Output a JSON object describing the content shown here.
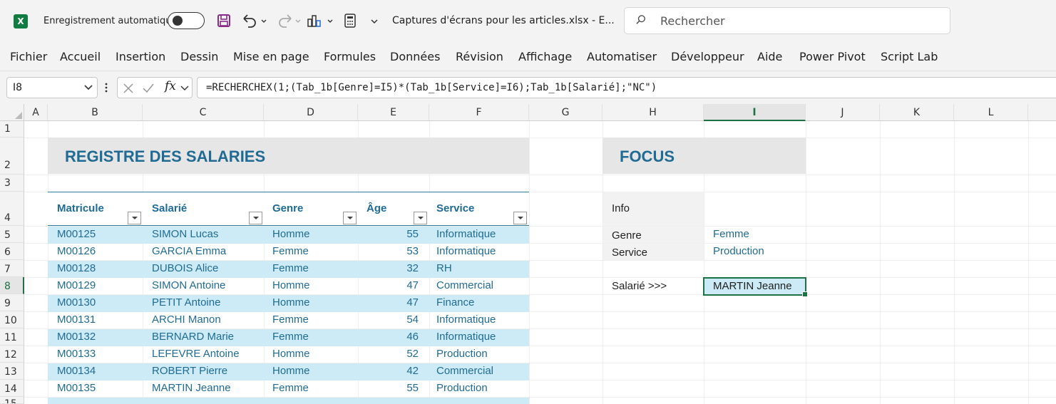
{
  "titlebar": {
    "logo": "X",
    "autosave_label": "Enregistrement automatique",
    "doc_title": "Captures d'écrans pour les articles.xlsx  -  E...",
    "search_placeholder": "Rechercher"
  },
  "ribbon": {
    "tabs": [
      "Fichier",
      "Accueil",
      "Insertion",
      "Dessin",
      "Mise en page",
      "Formules",
      "Données",
      "Révision",
      "Affichage",
      "Automatiser",
      "Développeur",
      "Aide",
      "Power Pivot",
      "Script Lab"
    ]
  },
  "formula_bar": {
    "namebox": "I8",
    "formula": "=RECHERCHEX(1;(Tab_1b[Genre]=I5)*(Tab_1b[Service]=I6);Tab_1b[Salarié];\"NC\")"
  },
  "columns": [
    "A",
    "B",
    "C",
    "D",
    "E",
    "F",
    "G",
    "H",
    "I",
    "J",
    "K",
    "L"
  ],
  "rows": [
    "1",
    "2",
    "3",
    "4",
    "5",
    "6",
    "7",
    "8",
    "9",
    "10",
    "11",
    "12",
    "13",
    "14",
    "15"
  ],
  "register": {
    "title": "REGISTRE DES SALARIES",
    "headers": [
      "Matricule",
      "Salarié",
      "Genre",
      "Âge",
      "Service"
    ],
    "rows": [
      [
        "M00125",
        "SIMON Lucas",
        "Homme",
        "55",
        "Informatique"
      ],
      [
        "M00126",
        "GARCIA Emma",
        "Femme",
        "53",
        "Informatique"
      ],
      [
        "M00128",
        "DUBOIS Alice",
        "Femme",
        "32",
        "RH"
      ],
      [
        "M00129",
        "SIMON Antoine",
        "Homme",
        "47",
        "Commercial"
      ],
      [
        "M00130",
        "PETIT Antoine",
        "Homme",
        "47",
        "Finance"
      ],
      [
        "M00131",
        "ARCHI Manon",
        "Femme",
        "54",
        "Informatique"
      ],
      [
        "M00132",
        "BERNARD Marie",
        "Femme",
        "46",
        "Informatique"
      ],
      [
        "M00133",
        "LEFEVRE Antoine",
        "Homme",
        "52",
        "Production"
      ],
      [
        "M00134",
        "ROBERT Pierre",
        "Homme",
        "42",
        "Commercial"
      ],
      [
        "M00135",
        "MARTIN Jeanne",
        "Femme",
        "55",
        "Production"
      ]
    ]
  },
  "focus": {
    "title": "FOCUS",
    "info_label": "Info",
    "genre_label": "Genre",
    "genre_value": "Femme",
    "service_label": "Service",
    "service_value": "Production",
    "salarie_label": "Salarié >>>",
    "salarie_value": "MARTIN Jeanne"
  },
  "colors": {
    "accent": "#1f6b94",
    "band": "#ccebf7",
    "selection": "#1e7145"
  }
}
